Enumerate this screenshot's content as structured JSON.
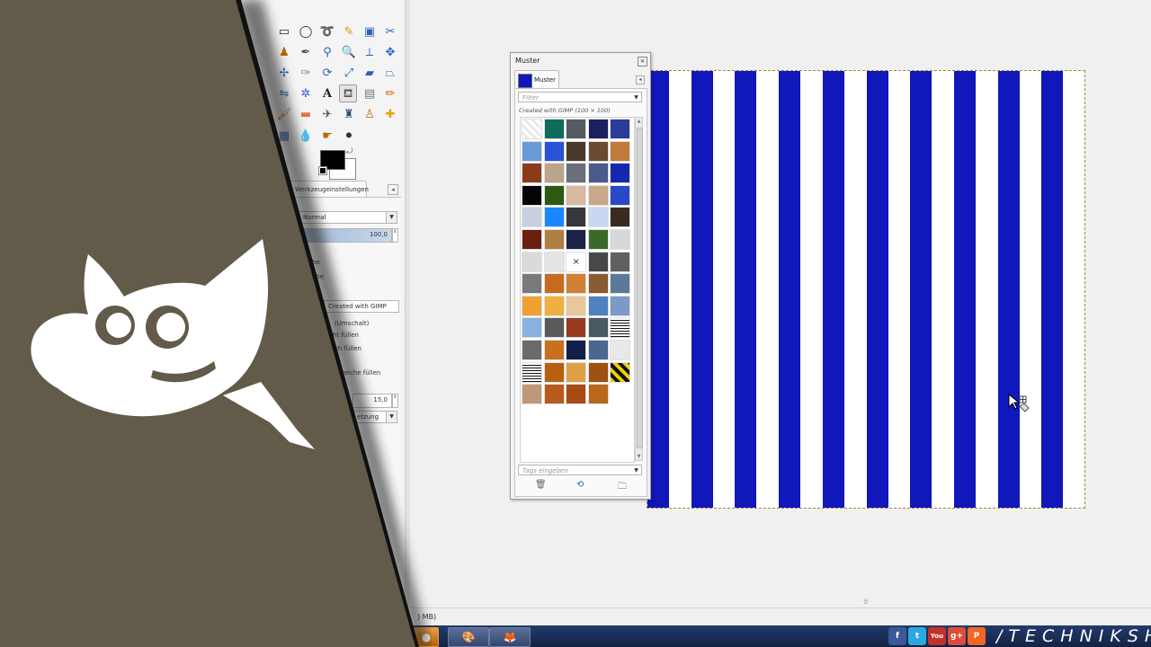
{
  "toolbox": {
    "tabs": {
      "tool_options": "Werkzeugeinstellungen"
    },
    "options": {
      "mode_value": "Normal",
      "opacity_value": "100,0",
      "partial_1": "be",
      "partial_2": "abe",
      "pattern_value": "Created with GIMP",
      "partial_3": "(Umschalt)",
      "partial_4": "ht füllen",
      "partial_5": "ich füllen",
      "partial_6": "reiche füllen",
      "threshold_value": "15,0",
      "partial_7": "etzung"
    },
    "colors": {
      "foreground": "#000000",
      "background": "#ffffff"
    }
  },
  "muster": {
    "title": "Muster",
    "tab_label": "Muster",
    "filter_placeholder": "Filter",
    "pattern_info": "Created with GIMP (100 × 100)",
    "tags_placeholder": "Tags eingeben",
    "patterns": [
      "#fafafa",
      "#0e6b5c",
      "#555a63",
      "#1a2060",
      "#2c3c9a",
      "#6a9ad8",
      "#2a52d6",
      "#4a3a2a",
      "#6a4a30",
      "#c07a3a",
      "#8a3c1a",
      "#bba58a",
      "#6a6f78",
      "#4a5a8a",
      "#1628b0",
      "#050505",
      "#2d5a10",
      "#d8b8a0",
      "#c8a888",
      "#2a48c8",
      "#c8d0e0",
      "#1a86ff",
      "#38383c",
      "#c8d8f0",
      "#3a2a22",
      "#6a1e10",
      "#b08040",
      "#1a2248",
      "#3a6a2a",
      "#d8d8d8",
      "#dadada",
      "#e4e4e4",
      "#ffffff",
      "#484848",
      "#606060",
      "#7a7a7a",
      "#c86a20",
      "#d08030",
      "#8a5a30",
      "#5a7a98",
      "#f0a030",
      "#f0b040",
      "#e8c898",
      "#5080c0",
      "#7a9ac8",
      "#8ab0e0",
      "#5a5a5a",
      "#9a3a20",
      "#4a5a60",
      "#a8c0e0",
      "#6a6a6a",
      "#c87020",
      "#102048",
      "#486890",
      "#e8e8e8",
      "#9a9a9a",
      "#b86010",
      "#e0a048",
      "#a05010",
      "#f0d000",
      "#c09878",
      "#b85a1c",
      "#a84a14",
      "#b8681c"
    ],
    "pattern_x_symbol": "×"
  },
  "status": {
    "memory": ") MB)"
  },
  "social": [
    "f",
    "t",
    "You",
    "g+",
    "P"
  ],
  "brand_text": "/TECHNIKSH",
  "canvas": {
    "stripe_color": "#1017bb",
    "background": "#ffffff"
  }
}
